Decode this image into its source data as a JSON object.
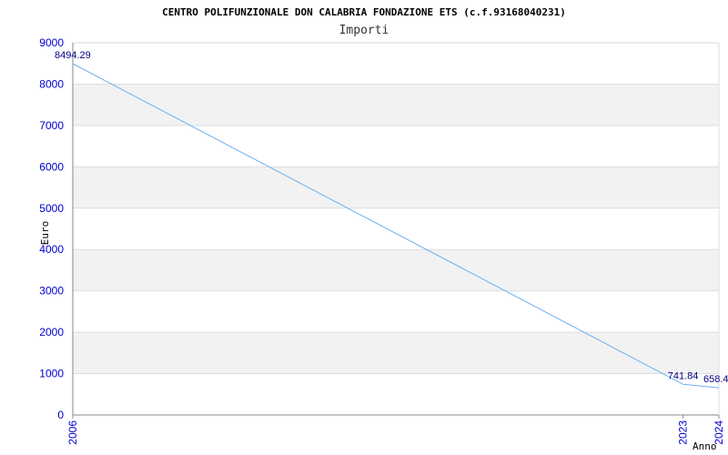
{
  "chart_data": {
    "type": "line",
    "title": "CENTRO POLIFUNZIONALE DON CALABRIA FONDAZIONE ETS (c.f.93168040231)",
    "subtitle": "Importi",
    "xlabel": "Anno",
    "ylabel": "Euro",
    "x": [
      "2006",
      "2023",
      "2024"
    ],
    "values": [
      8494.29,
      741.84,
      658.4
    ],
    "data_labels": [
      "8494.29",
      "741.84",
      "658.4"
    ],
    "ylim": [
      0,
      9000
    ],
    "yticks": [
      "0",
      "1000",
      "2000",
      "3000",
      "4000",
      "5000",
      "6000",
      "7000",
      "8000",
      "9000"
    ],
    "grid": "alternating horizontal bands",
    "colors": {
      "line": "#6ab0f3",
      "band": "#f2f2f2",
      "tick_text": "#0000cc",
      "data_label": "#000080"
    }
  }
}
